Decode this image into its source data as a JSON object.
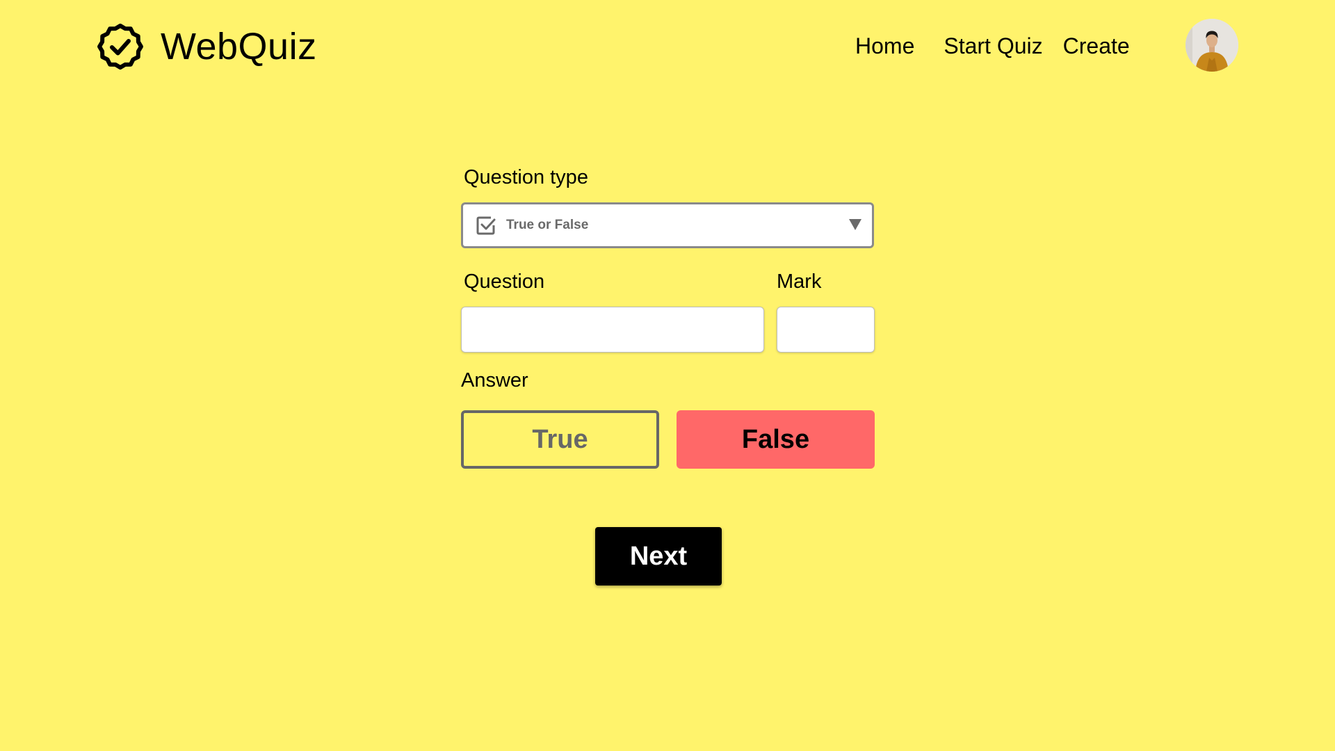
{
  "brand": {
    "name": "WebQuiz",
    "icon": "verified-badge-icon"
  },
  "nav": {
    "home": "Home",
    "start_quiz": "Start Quiz",
    "create": "Create"
  },
  "user": {
    "avatar_icon": "user-avatar"
  },
  "form": {
    "question_type_label": "Question type",
    "question_type_value": "True or False",
    "question_type_icon": "checkbox-checked-icon",
    "question_label": "Question",
    "question_value": "",
    "mark_label": "Mark",
    "mark_value": "",
    "answer_label": "Answer",
    "answers": {
      "true_label": "True",
      "false_label": "False",
      "selected": "False"
    },
    "next_label": "Next"
  },
  "colors": {
    "background": "#FFF36C",
    "selected_answer": "#FF6868",
    "next_button": "#000000"
  }
}
